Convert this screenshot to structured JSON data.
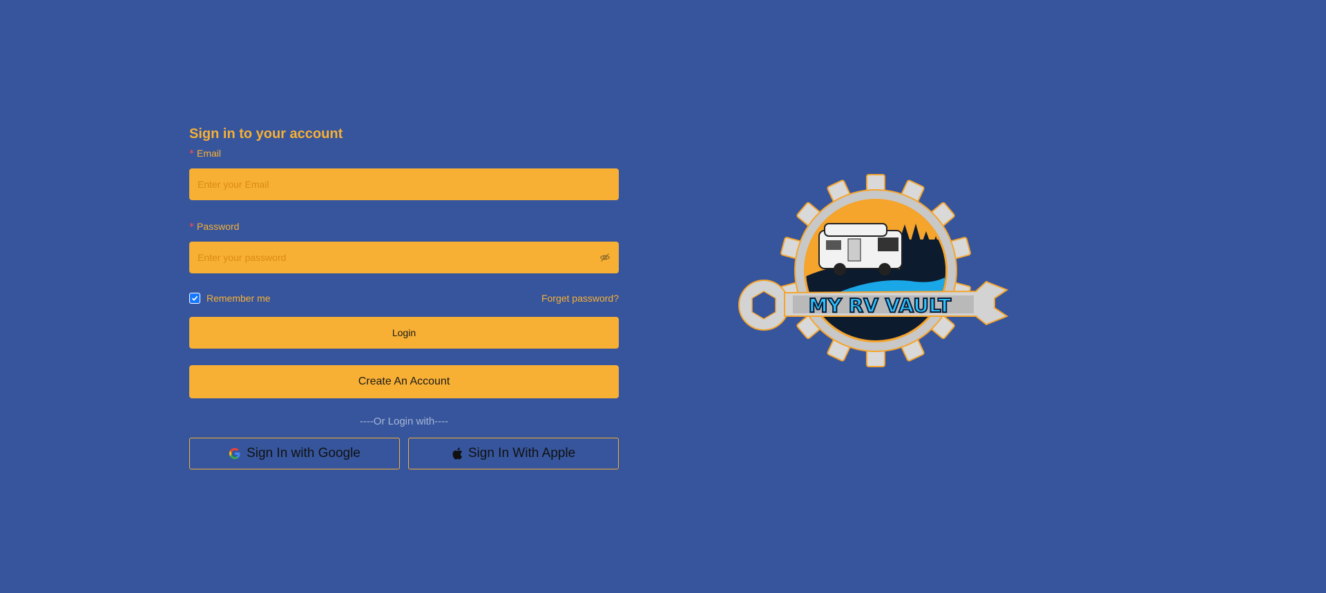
{
  "login_form": {
    "title": "Sign in to your account",
    "email": {
      "required_mark": "*",
      "label": "Email",
      "placeholder": "Enter your Email",
      "value": ""
    },
    "password": {
      "required_mark": "*",
      "label": "Password",
      "placeholder": "Enter your password",
      "value": "",
      "visibility_icon": "eye-invisible-icon"
    },
    "remember_me": {
      "label": "Remember me",
      "checked": true
    },
    "forget_password_label": "Forget password?",
    "login_button_label": "Login",
    "create_account_button_label": "Create An Account",
    "divider_text": "----Or Login with----",
    "social": {
      "google_label": "Sign In with Google",
      "google_icon": "google-icon",
      "apple_label": "Sign In With Apple",
      "apple_icon": "apple-icon"
    }
  },
  "logo": {
    "text": "MY RV VAULT"
  },
  "colors": {
    "background": "#36559c",
    "accent": "#f8b034",
    "placeholder": "#d98a14",
    "required": "#ff4d4f",
    "checkbox": "#1677ff",
    "divider_text": "#a9b7d8"
  }
}
